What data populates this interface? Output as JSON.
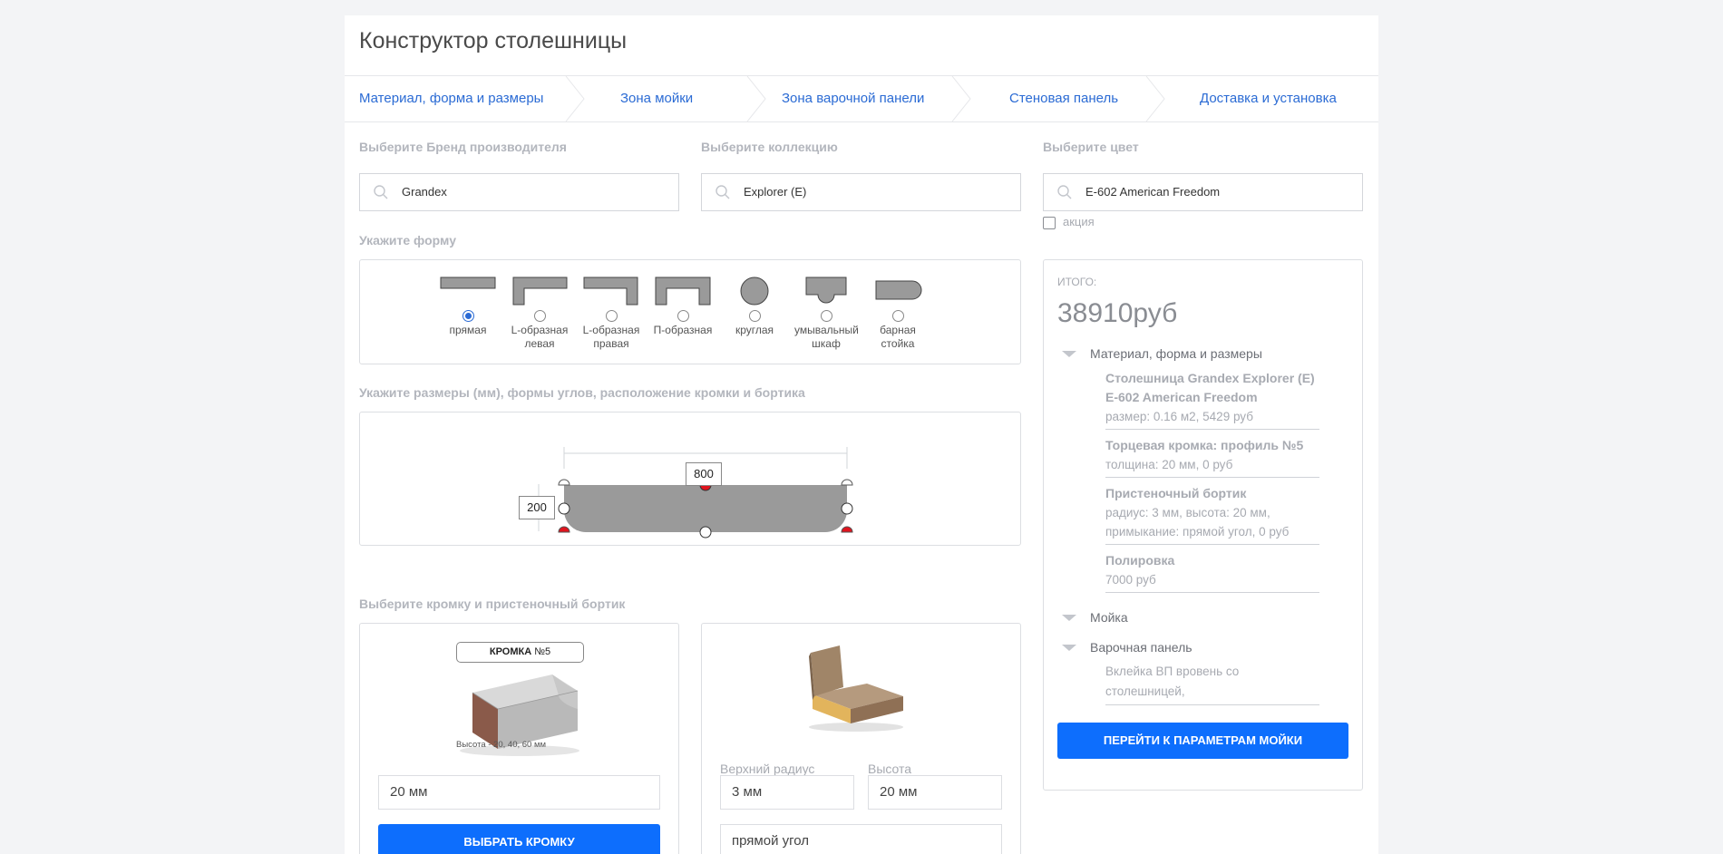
{
  "page": {
    "title": "Конструктор столешницы"
  },
  "steps": [
    "Материал, форма и размеры",
    "Зона мойки",
    "Зона варочной панели",
    "Стеновая панель",
    "Доставка и установка"
  ],
  "selectors": {
    "brand_label": "Выберите Бренд производителя",
    "brand_value": "Grandex",
    "collection_label": "Выберите коллекцию",
    "collection_value": "Explorer (E)",
    "color_label": "Выберите цвет",
    "color_value": "E-602 American Freedom",
    "promo_label": "акция",
    "promo_checked": false
  },
  "shape": {
    "label": "Укажите форму",
    "options": [
      {
        "line1": "прямая",
        "line2": "",
        "selected": true
      },
      {
        "line1": "L-образная",
        "line2": "левая",
        "selected": false
      },
      {
        "line1": "L-образная",
        "line2": "правая",
        "selected": false
      },
      {
        "line1": "П-образная",
        "line2": "",
        "selected": false
      },
      {
        "line1": "круглая",
        "line2": "",
        "selected": false
      },
      {
        "line1": "умывальный",
        "line2": "шкаф",
        "selected": false
      },
      {
        "line1": "барная",
        "line2": "стойка",
        "selected": false
      }
    ]
  },
  "dimensions": {
    "label": "Укажите размеры (мм), формы углов, расположение кромки и бортика",
    "width": "800",
    "depth": "200"
  },
  "edge": {
    "label": "Выберите кромку и пристеночный бортик",
    "card_title_bold": "КРОМКА",
    "card_title_rest": " №5",
    "card_caption": "Высота - 20, 40, 60 мм",
    "thickness_value": "20 мм",
    "select_button": "ВЫБРАТЬ КРОМКУ"
  },
  "backsplash": {
    "radius_label": "Верхний радиус",
    "height_label": "Высота",
    "radius_value": "3 мм",
    "height_value": "20 мм",
    "corner_value": "прямой угол"
  },
  "summary": {
    "total_label": "ИТОГО:",
    "total_value": "38910руб",
    "section_material": "Материал, форма и размеры",
    "items": [
      {
        "title1": "Столешница Grandex Explorer (E)",
        "title2": "E-602 American Freedom",
        "sub1": "размер: 0.16 м2, 5429 руб",
        "sub2": ""
      },
      {
        "title1": "Торцевая кромка: профиль №5",
        "title2": "",
        "sub1": "толщина: 20 мм, 0 руб",
        "sub2": ""
      },
      {
        "title1": "Пристеночный бортик",
        "title2": "",
        "sub1": "радиус: 3 мм, высота: 20 мм,",
        "sub2": "примыкание: прямой угол, 0 руб"
      },
      {
        "title1": "Полировка",
        "title2": "",
        "sub1": "7000 руб",
        "sub2": ""
      }
    ],
    "section_sink": "Мойка",
    "section_hob": "Варочная панель",
    "hob_item_1": "Вклейка ВП вровень со",
    "hob_item_2": "столешницей,",
    "next_button": "ПЕРЕЙТИ К ПАРАМЕТРАМ МОЙКИ"
  },
  "colors": {
    "accent": "#0d6efd",
    "link": "#2b6bd4",
    "marker_red": "#e0141e",
    "countertop": "#9a9a9a"
  }
}
